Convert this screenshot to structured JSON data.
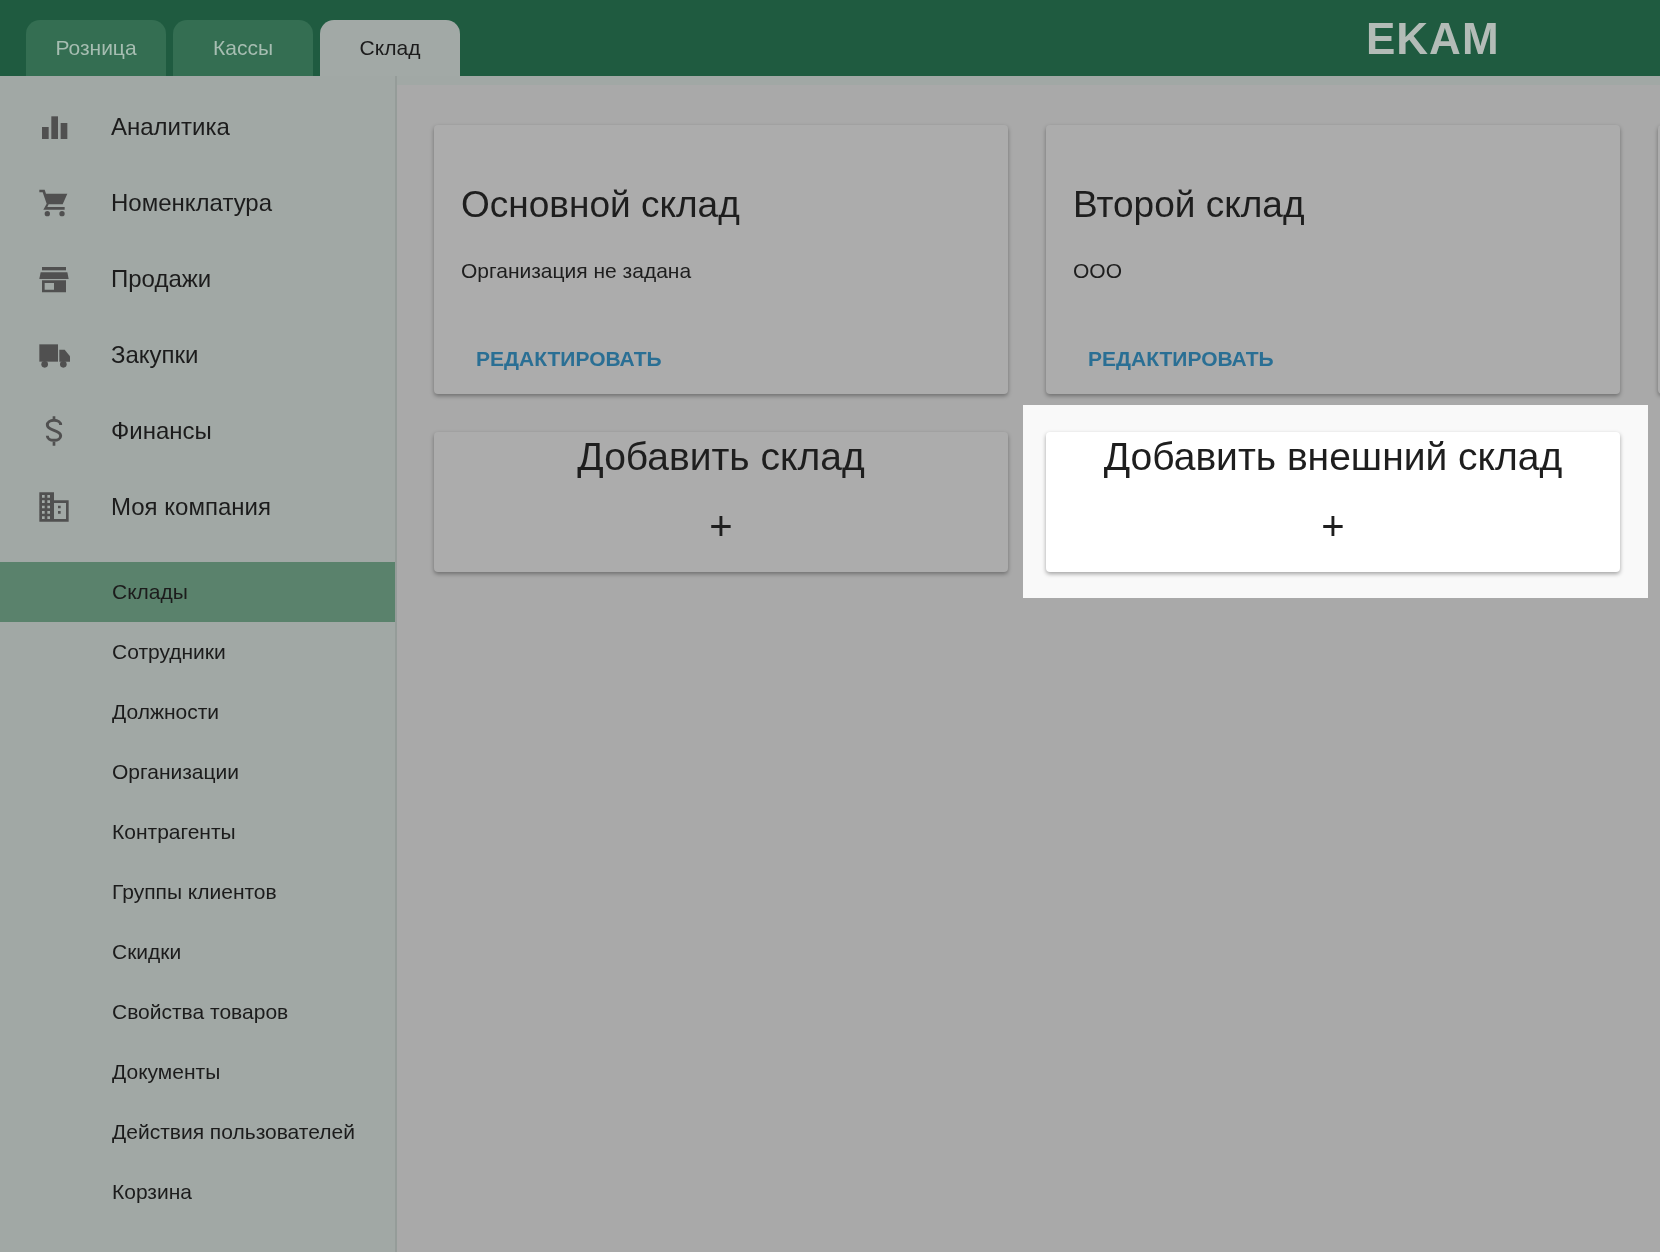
{
  "header": {
    "tabs": [
      {
        "label": "Розница",
        "selected": false
      },
      {
        "label": "Кассы",
        "selected": false
      },
      {
        "label": "Склад",
        "selected": true
      }
    ],
    "logo": "EKAM"
  },
  "sidebar": {
    "items": [
      {
        "label": "Аналитика"
      },
      {
        "label": "Номенклатура"
      },
      {
        "label": "Продажи"
      },
      {
        "label": "Закупки"
      },
      {
        "label": "Финансы"
      },
      {
        "label": "Моя компания"
      }
    ],
    "subitems": [
      {
        "label": "Склады",
        "selected": true
      },
      {
        "label": "Сотрудники",
        "selected": false
      },
      {
        "label": "Должности",
        "selected": false
      },
      {
        "label": "Организации",
        "selected": false
      },
      {
        "label": "Контрагенты",
        "selected": false
      },
      {
        "label": "Группы клиентов",
        "selected": false
      },
      {
        "label": "Скидки",
        "selected": false
      },
      {
        "label": "Свойства товаров",
        "selected": false
      },
      {
        "label": "Документы",
        "selected": false
      },
      {
        "label": "Действия пользователей",
        "selected": false
      },
      {
        "label": "Корзина",
        "selected": false
      }
    ]
  },
  "warehouses": [
    {
      "title": "Основной склад",
      "organization": "Организация не задана",
      "action": "РЕДАКТИРОВАТЬ"
    },
    {
      "title": "Второй склад",
      "organization": "ООО",
      "action": "РЕДАКТИРОВАТЬ"
    }
  ],
  "add_cards": [
    {
      "label": "Добавить склад",
      "plus": "+",
      "highlighted": false
    },
    {
      "label": "Добавить внешний склад",
      "plus": "+",
      "highlighted": true
    }
  ]
}
